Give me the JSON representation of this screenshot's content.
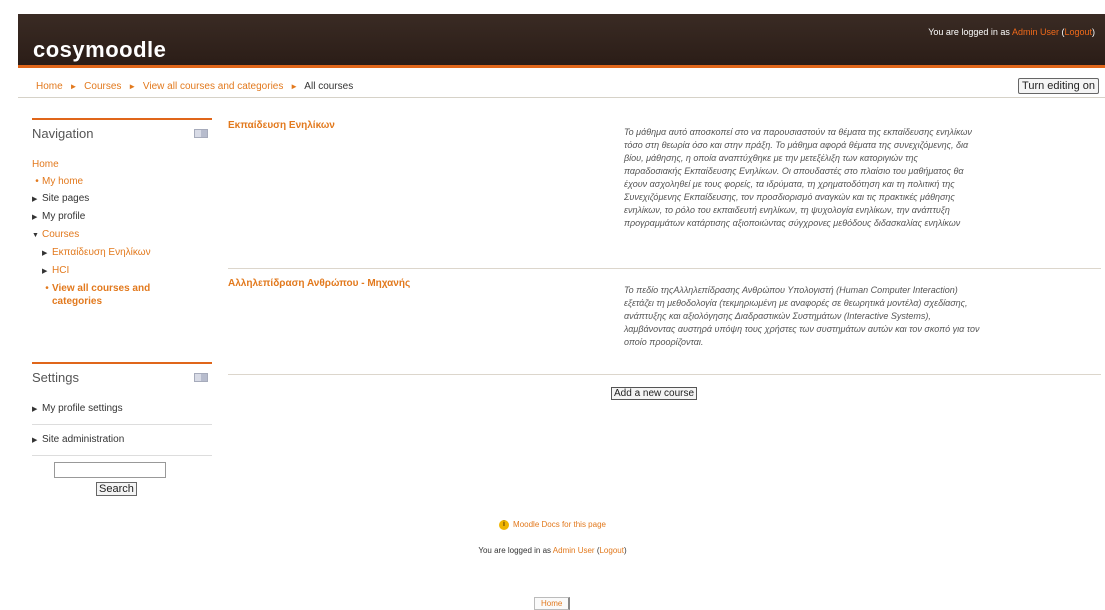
{
  "header": {
    "logo": "cosymoodle",
    "login_prefix": "You are logged in as ",
    "user_name": "Admin User",
    "logout_open": " (",
    "logout": "Logout",
    "logout_close": ")"
  },
  "breadcrumb": {
    "items": [
      "Home",
      "Courses",
      "View all courses and categories",
      "All courses"
    ],
    "separator": "►"
  },
  "turn_editing_label": "Turn editing on",
  "navigation": {
    "title": "Navigation",
    "home": "Home",
    "my_home": "My home",
    "site_pages": "Site pages",
    "my_profile": "My profile",
    "courses": "Courses",
    "course_1": "Εκπαίδευση Ενηλίκων",
    "course_2": "HCI",
    "view_all_line1": "View all courses and",
    "view_all_line2": "categories"
  },
  "settings": {
    "title": "Settings",
    "my_profile_settings": "My profile settings",
    "site_administration": "Site administration",
    "search_button": "Search"
  },
  "courses": [
    {
      "name": "Εκπαίδευση Ενηλίκων",
      "summary_lines": [
        "Το μάθημα αυτό αποσκοπεί στο να παρουσιαστούν τα θέματα της εκπαίδευσης ενηλίκων",
        "τόσο στη θεωρία όσο και στην πράξη. Το μάθημα αφορά θέματα της συνεχιζόμενης, δια",
        "βίου, μάθησης, η οποία αναπτύχθηκε με την μετεξέλιξη των κατοριγιών της",
        "παραδοσιακής Εκπαίδευσης Ενηλίκων. Οι σπουδαστές στο πλαίσιο του μαθήματος θα",
        "έχουν ασχοληθεί με τους φορείς, τα ιδρύματα, τη χρηματοδότηση και τη πολιτική της",
        "Συνεχιζόμενης Εκπαίδευσης, τον προσδιορισμό αναγκών και τις πρακτικές μάθησης",
        "ενηλίκων, το ρόλο του εκπαιδευτή ενηλίκων, τη ψυχολογία ενηλίκων, την ανάπτυξη",
        "προγραμμάτων κατάρτισης αξιοποιώντας σύγχρονες μεθόδους διδασκαλίας ενηλίκων"
      ]
    },
    {
      "name": "Αλληλεπίδραση Ανθρώπου - Μηχανής",
      "summary_lines": [
        "Το πεδίο τηςΑλληλεπίδρασης Ανθρώπου Υπολογιστή (Human Computer Interaction)",
        "εξετάζει τη μεθοδολογία (τεκμηριωμένη με αναφορές σε θεωρητικά μοντέλα) σχεδίασης,",
        "ανάπτυξης και αξιολόγησης Διαδραστικών Συστημάτων (Interactive Systems),",
        "λαμβάνοντας αυστηρά υπόψη τους χρήστες των συστημάτων αυτών και τον σκοπό για τον",
        "οποίο προορίζονται."
      ]
    }
  ],
  "add_course_label": "Add a new course",
  "footer": {
    "docs_link": "Moodle Docs for this page",
    "login_prefix": "You are logged in as ",
    "user_name": "Admin User",
    "logout_open": " (",
    "logout": "Logout",
    "logout_close": ")",
    "home_button": "Home"
  },
  "colors": {
    "accent": "#e2791d",
    "header_bg": "#2b1d17",
    "header_stripe": "#e0661a"
  },
  "icons": {
    "tree_collapsed": "triangle-right-icon",
    "tree_expanded": "triangle-down-icon",
    "leaf": "bullet-icon",
    "dock": "dock-block-icon",
    "docs": "moodle-docs-icon"
  }
}
